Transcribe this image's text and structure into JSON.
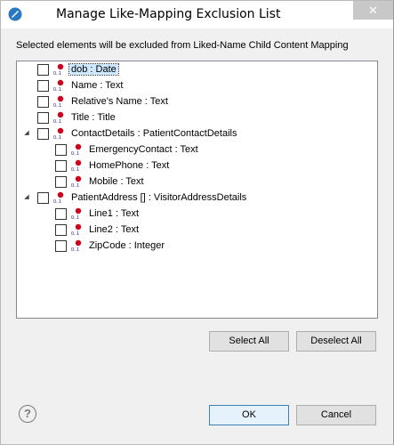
{
  "window": {
    "title": "Manage Like-Mapping Exclusion List",
    "close_glyph": "✕"
  },
  "instruction": "Selected elements will be excluded from Liked-Name Child Content Mapping",
  "tree": {
    "rows": [
      {
        "level": 0,
        "expander": "",
        "label": "dob  : Date",
        "selected": true
      },
      {
        "level": 0,
        "expander": "",
        "label": "Name  : Text",
        "selected": false
      },
      {
        "level": 0,
        "expander": "",
        "label": "Relative's Name  : Text",
        "selected": false
      },
      {
        "level": 0,
        "expander": "",
        "label": "Title  : Title",
        "selected": false
      },
      {
        "level": 0,
        "expander": "◢",
        "label": "ContactDetails  : PatientContactDetails",
        "selected": false
      },
      {
        "level": 1,
        "expander": "",
        "label": "EmergencyContact  : Text",
        "selected": false
      },
      {
        "level": 1,
        "expander": "",
        "label": "HomePhone  : Text",
        "selected": false
      },
      {
        "level": 1,
        "expander": "",
        "label": "Mobile  : Text",
        "selected": false
      },
      {
        "level": 0,
        "expander": "◢",
        "label": "PatientAddress []  : VisitorAddressDetails",
        "selected": false
      },
      {
        "level": 1,
        "expander": "",
        "label": "Line1  : Text",
        "selected": false
      },
      {
        "level": 1,
        "expander": "",
        "label": "Line2  : Text",
        "selected": false
      },
      {
        "level": 1,
        "expander": "",
        "label": "ZipCode  : Integer",
        "selected": false
      }
    ]
  },
  "buttons": {
    "select_all": "Select All",
    "deselect_all": "Deselect All",
    "ok": "OK",
    "cancel": "Cancel",
    "help": "?"
  },
  "icon_badge": "0..1",
  "colors": {
    "accent": "#3c7fb1",
    "selection": "#cde8ff",
    "node_icon_red": "#d0021b"
  }
}
